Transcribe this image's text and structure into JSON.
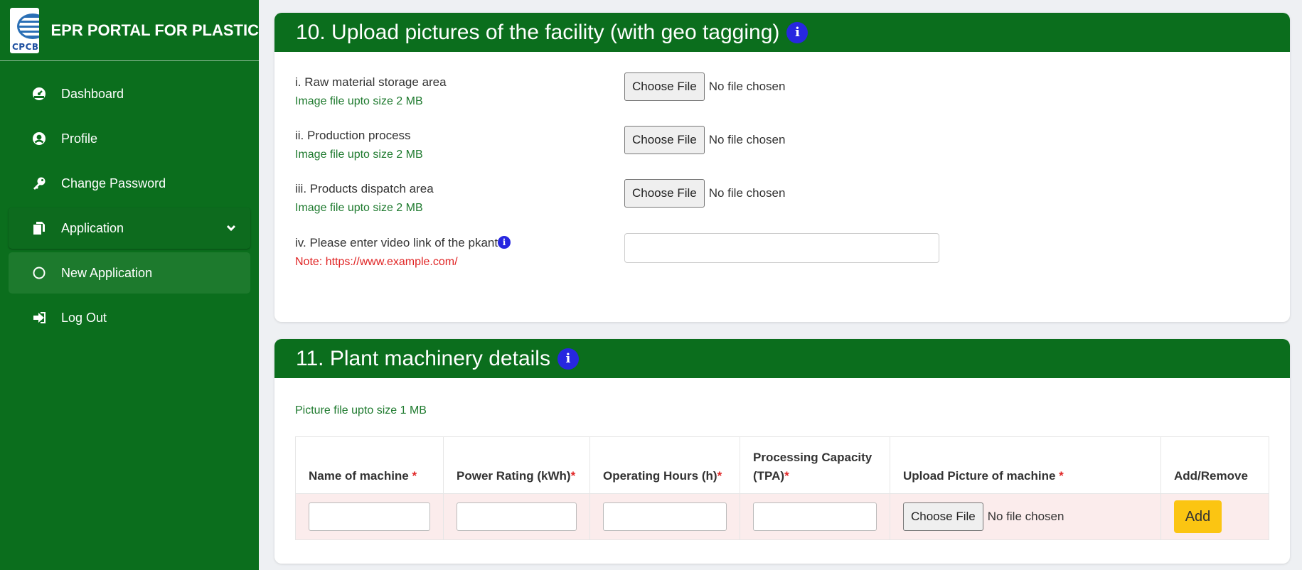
{
  "app": {
    "title": "EPR PORTAL FOR PLASTIC",
    "logo_text": "CPCB"
  },
  "nav": {
    "items": [
      {
        "label": "Dashboard",
        "icon": "dashboard-icon"
      },
      {
        "label": "Profile",
        "icon": "user-circle-icon"
      },
      {
        "label": "Change Password",
        "icon": "key-icon"
      },
      {
        "label": "Application",
        "icon": "documents-icon"
      },
      {
        "label": "New Application",
        "icon": "circle-outline-icon"
      },
      {
        "label": "Log Out",
        "icon": "logout-icon"
      }
    ]
  },
  "section10": {
    "title": "10. Upload pictures of the facility (with geo tagging)",
    "info_glyph": "i",
    "rows": [
      {
        "label": "i. Raw material storage area",
        "hint": "Image file upto size 2 MB",
        "button": "Choose File",
        "status": "No file chosen"
      },
      {
        "label": "ii. Production process",
        "hint": "Image file upto size 2 MB",
        "button": "Choose File",
        "status": "No file chosen"
      },
      {
        "label": "iii. Products dispatch area",
        "hint": "Image file upto size 2 MB",
        "button": "Choose File",
        "status": "No file chosen"
      }
    ],
    "video": {
      "label": "iv. Please enter video link of the pkant",
      "note": "Note: https://www.example.com/",
      "value": ""
    }
  },
  "section11": {
    "title": "11. Plant machinery details",
    "info_glyph": "i",
    "hint": "Picture file upto size 1 MB",
    "columns": [
      {
        "label": "Name of machine",
        "req": "*"
      },
      {
        "label": "Power Rating (kWh)",
        "req": "*"
      },
      {
        "label": "Operating Hours (h)",
        "req": "*"
      },
      {
        "label": "Processing Capacity (TPA)",
        "req": "*"
      },
      {
        "label": "Upload Picture of machine",
        "req": "*"
      },
      {
        "label": "Add/Remove",
        "req": ""
      }
    ],
    "row": {
      "file_button": "Choose File",
      "file_status": "No file chosen",
      "add_label": "Add"
    }
  },
  "colors": {
    "brand_green": "#0b6e1d",
    "info_blue": "#2727e0",
    "required_red": "#e02424",
    "hint_green": "#1e7a2e",
    "add_yellow": "#fbc512"
  }
}
